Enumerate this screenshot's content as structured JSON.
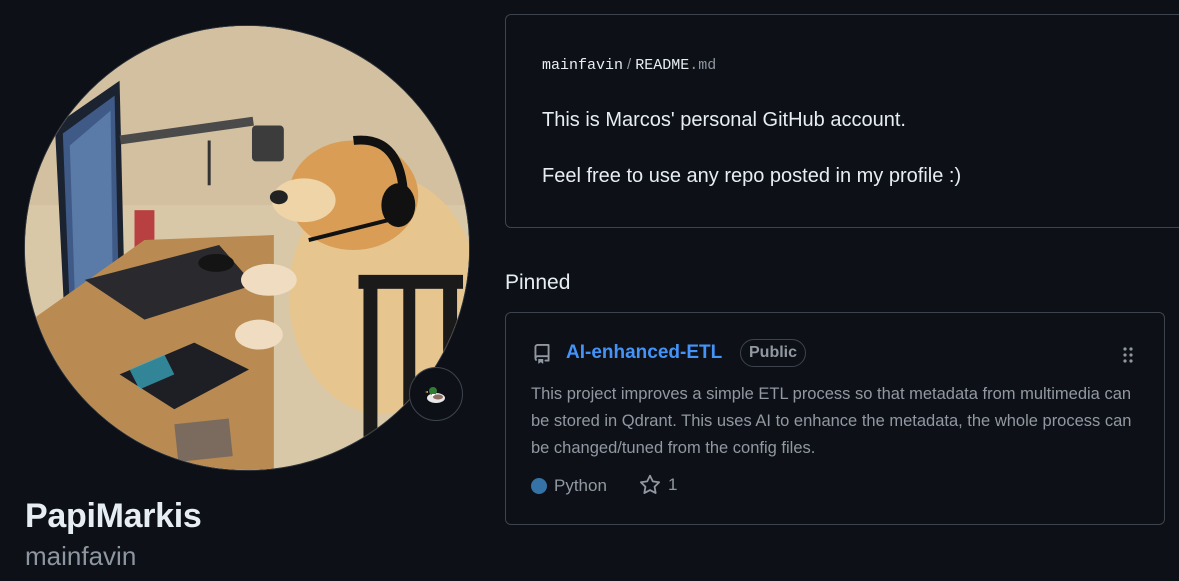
{
  "profile": {
    "display_name": "PapiMarkis",
    "login": "mainfavin",
    "avatar_alt": "avatar",
    "status_icon": "duck-emoji-icon"
  },
  "readme": {
    "owner": "mainfavin",
    "separator": "/",
    "file_base": "README",
    "file_ext": ".md",
    "lines": [
      "This is Marcos' personal GitHub account.",
      "Feel free to use any repo posted in my profile :)"
    ]
  },
  "pinned": {
    "heading": "Pinned",
    "repos": [
      {
        "name": "AI-enhanced-ETL",
        "visibility": "Public",
        "description": "This project improves a simple ETL process so that metadata from multimedia can be stored in Qdrant. This uses AI to enhance the metadata, the whole process can be changed/tuned from the config files.",
        "language": "Python",
        "language_color": "#3572a5",
        "stars": "1"
      }
    ]
  },
  "colors": {
    "background": "#0d1117",
    "border": "#3d444d",
    "link": "#4493f8",
    "muted": "#9198a1",
    "text": "#e6edf3"
  }
}
